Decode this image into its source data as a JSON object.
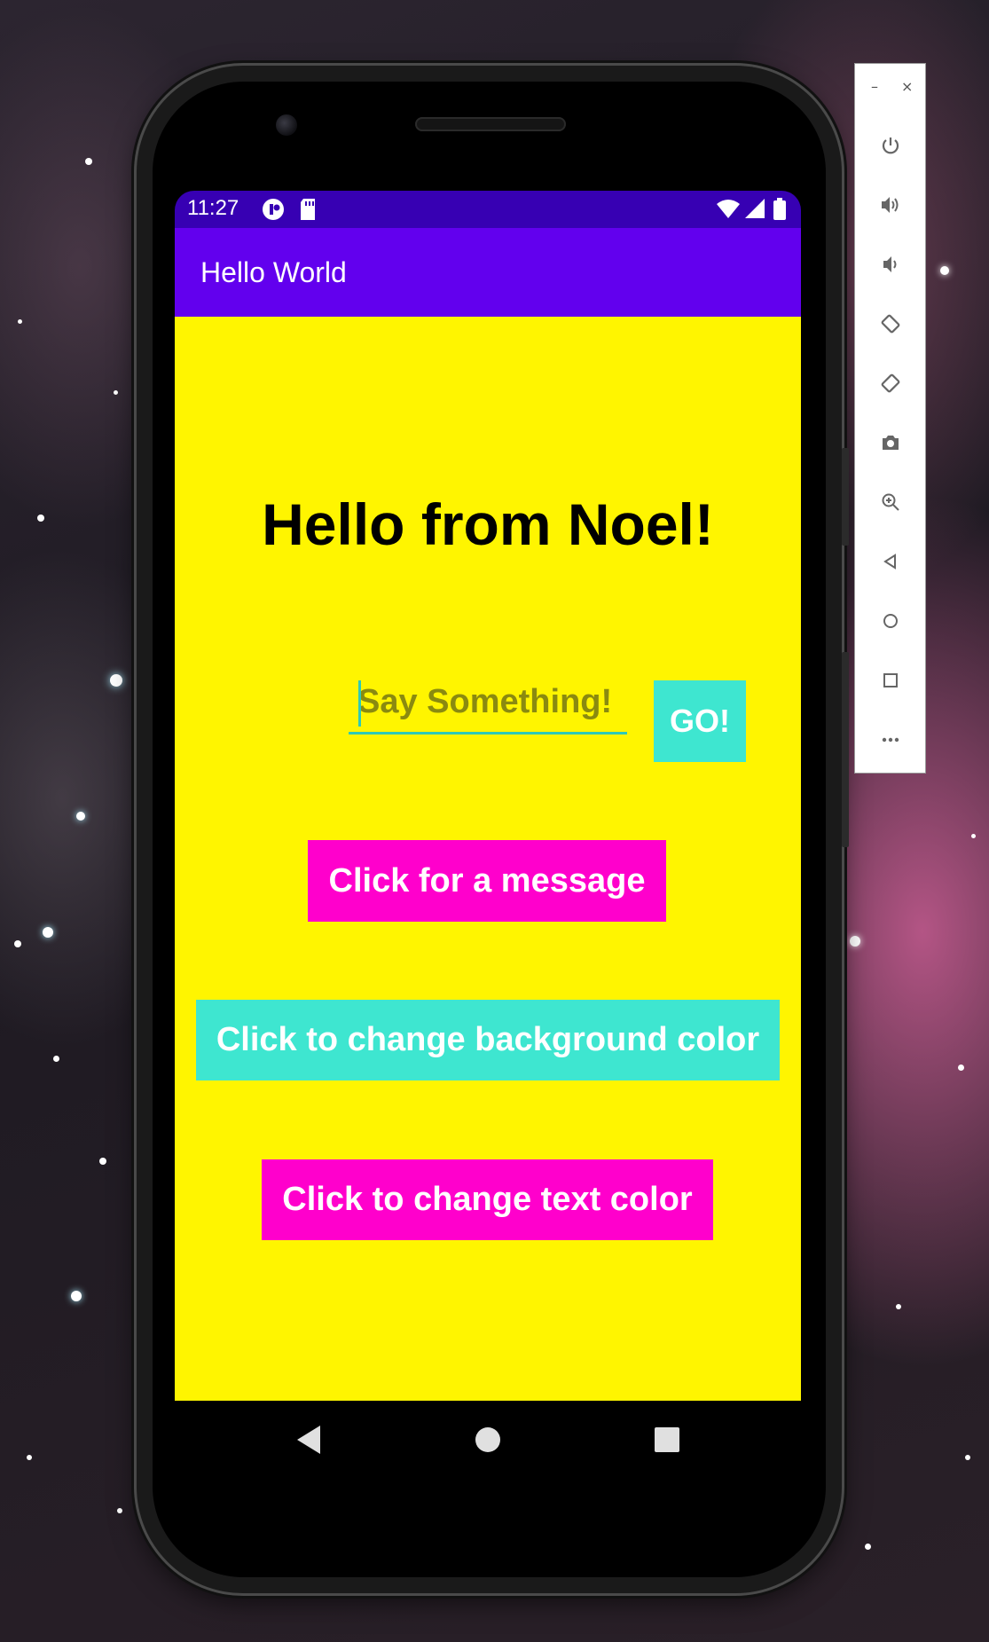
{
  "status_bar": {
    "time": "11:27"
  },
  "app": {
    "title": "Hello World"
  },
  "main": {
    "greeting": "Hello from Noel!",
    "say_input": {
      "placeholder": "Say Something!",
      "value": ""
    },
    "go_button": "GO!",
    "message_button": "Click for a message",
    "background_button": "Click to change background color",
    "text_color_button": "Click to change text color"
  },
  "colors": {
    "status_bar": "#3700b3",
    "app_bar": "#6200ee",
    "background": "#fff500",
    "turquoise": "#3ee6d0",
    "magenta": "#ff00cc"
  },
  "toolbar": {
    "minimize": "–",
    "close": "×",
    "items": [
      "power-icon",
      "volume-up-icon",
      "volume-down-icon",
      "rotate-left-icon",
      "rotate-right-icon",
      "camera-icon",
      "zoom-icon",
      "back-icon",
      "home-icon",
      "overview-icon",
      "more-icon"
    ]
  },
  "nav_bar": {
    "items": [
      "back-icon",
      "home-icon",
      "recents-icon"
    ]
  }
}
